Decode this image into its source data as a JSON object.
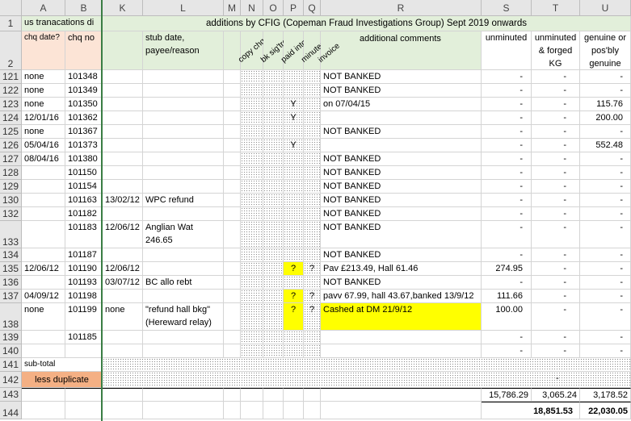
{
  "columns": [
    "A",
    "B",
    "K",
    "L",
    "M",
    "N",
    "O",
    "P",
    "Q",
    "R",
    "S",
    "T",
    "U"
  ],
  "header_row1": {
    "num": "1",
    "a_text": "us tranacations di",
    "title": "additions by CFIG (Copeman Fraud Investigations Group) Sept 2019 onwards"
  },
  "header_row2": {
    "num": "2",
    "a": "chq date?",
    "b": "chq no",
    "l": "stub date, payee/reason",
    "n": "copy chq",
    "o": "bk sig'tre",
    "p": "paid into",
    "q": "minuted",
    "r_invoice": "invoice",
    "r": "additional comments",
    "s": "unminuted",
    "t": "unminuted & forged KG",
    "u": "genuine or pos'bly genuine"
  },
  "rows": [
    {
      "num": "121",
      "a": "none",
      "b": "101348",
      "k": "",
      "l": "",
      "l2": "",
      "p": "",
      "q": "",
      "r": "NOT BANKED",
      "s": "-",
      "t": "-",
      "u": "-"
    },
    {
      "num": "122",
      "a": "none",
      "b": "101349",
      "k": "",
      "l": "",
      "l2": "",
      "p": "",
      "q": "",
      "r": "NOT BANKED",
      "s": "-",
      "t": "-",
      "u": "-"
    },
    {
      "num": "123",
      "a": "none",
      "b": "101350",
      "k": "",
      "l": "",
      "l2": "",
      "p": "Y",
      "q": "",
      "r": "on 07/04/15",
      "s": "-",
      "t": "-",
      "u": "115.76"
    },
    {
      "num": "124",
      "a": "12/01/16",
      "b": "101362",
      "k": "",
      "l": "",
      "l2": "",
      "p": "Y",
      "q": "",
      "r": "",
      "s": "-",
      "t": "-",
      "u": "200.00"
    },
    {
      "num": "125",
      "a": "none",
      "b": "101367",
      "k": "",
      "l": "",
      "l2": "",
      "p": "",
      "q": "",
      "r": "NOT BANKED",
      "s": "-",
      "t": "-",
      "u": "-"
    },
    {
      "num": "126",
      "a": "05/04/16",
      "b": "101373",
      "k": "",
      "l": "",
      "l2": "",
      "p": "Y",
      "q": "",
      "r": "",
      "s": "-",
      "t": "-",
      "u": "552.48"
    },
    {
      "num": "127",
      "a": "08/04/16",
      "b": "101380",
      "k": "",
      "l": "",
      "l2": "",
      "p": "",
      "q": "",
      "r": "NOT BANKED",
      "s": "-",
      "t": "-",
      "u": "-"
    },
    {
      "num": "128",
      "a": "",
      "b": "101150",
      "k": "",
      "l": "",
      "l2": "",
      "p": "",
      "q": "",
      "r": "NOT BANKED",
      "s": "-",
      "t": "-",
      "u": "-"
    },
    {
      "num": "129",
      "a": "",
      "b": "101154",
      "k": "",
      "l": "",
      "l2": "",
      "p": "",
      "q": "",
      "r": "NOT BANKED",
      "s": "-",
      "t": "-",
      "u": "-"
    },
    {
      "num": "130",
      "a": "",
      "b": "101163",
      "k": "13/02/12",
      "l": "WPC refund",
      "l2": "",
      "p": "",
      "q": "",
      "r": "NOT BANKED",
      "s": "-",
      "t": "-",
      "u": "-"
    },
    {
      "num": "132",
      "a": "",
      "b": "101182",
      "k": "",
      "l": "",
      "l2": "",
      "p": "",
      "q": "",
      "r": "NOT BANKED",
      "s": "-",
      "t": "-",
      "u": "-"
    },
    {
      "num": "133",
      "a": "",
      "b": "101183",
      "k": "12/06/12",
      "l": "Anglian Wat",
      "l2": "246.65",
      "p": "",
      "q": "",
      "r": "NOT BANKED",
      "s": "-",
      "t": "-",
      "u": "-"
    },
    {
      "num": "134",
      "a": "",
      "b": "101187",
      "k": "",
      "l": "",
      "l2": "",
      "p": "",
      "q": "",
      "r": "NOT BANKED",
      "s": "-",
      "t": "-",
      "u": "-"
    },
    {
      "num": "135",
      "a": "12/06/12",
      "b": "101190",
      "k": "12/06/12",
      "l": "",
      "l2": "",
      "p": "?",
      "q": "?",
      "r": "Pav £213.49, Hall 61.46",
      "s": "274.95",
      "t": "-",
      "u": "-"
    },
    {
      "num": "136",
      "a": "",
      "b": "101193",
      "k": "03/07/12",
      "l": "BC allo rebt",
      "l2": "",
      "p": "",
      "q": "",
      "r": "NOT BANKED",
      "s": "-",
      "t": "-",
      "u": "-"
    },
    {
      "num": "137",
      "a": "04/09/12",
      "b": "101198",
      "k": "",
      "l": "",
      "l2": "",
      "p": "?",
      "q": "?",
      "r": "pavv 67.99, hall 43.67,banked 13/9/12",
      "s": "111.66",
      "t": "-",
      "u": "-"
    },
    {
      "num": "138",
      "a": "none",
      "b": "101199",
      "k": "none",
      "l": "\"refund hall bkg\"",
      "l2": "(Hereward relay)",
      "p": "?",
      "q": "?",
      "r": "Cashed at DM 21/9/12",
      "s": "100.00",
      "t": "-",
      "u": "-"
    },
    {
      "num": "139",
      "a": "",
      "b": "101185",
      "k": "",
      "l": "",
      "l2": "",
      "p": "",
      "q": "",
      "r": "",
      "s": "-",
      "t": "-",
      "u": "-"
    },
    {
      "num": "140",
      "a": "",
      "b": "",
      "k": "",
      "l": "",
      "l2": "",
      "p": "",
      "q": "",
      "r": "",
      "s": "-",
      "t": "-",
      "u": "-"
    }
  ],
  "subtotal": {
    "num": "141",
    "label": "sub-total"
  },
  "less_duplicate": {
    "num": "142",
    "label": "less duplicate",
    "t": "-"
  },
  "totals_row": {
    "num": "143",
    "s": "15,786.29",
    "t": "3,065.24",
    "u": "3,178.52"
  },
  "grand_row": {
    "num": "144",
    "s": "18,851.53",
    "u": "22,030.05"
  }
}
